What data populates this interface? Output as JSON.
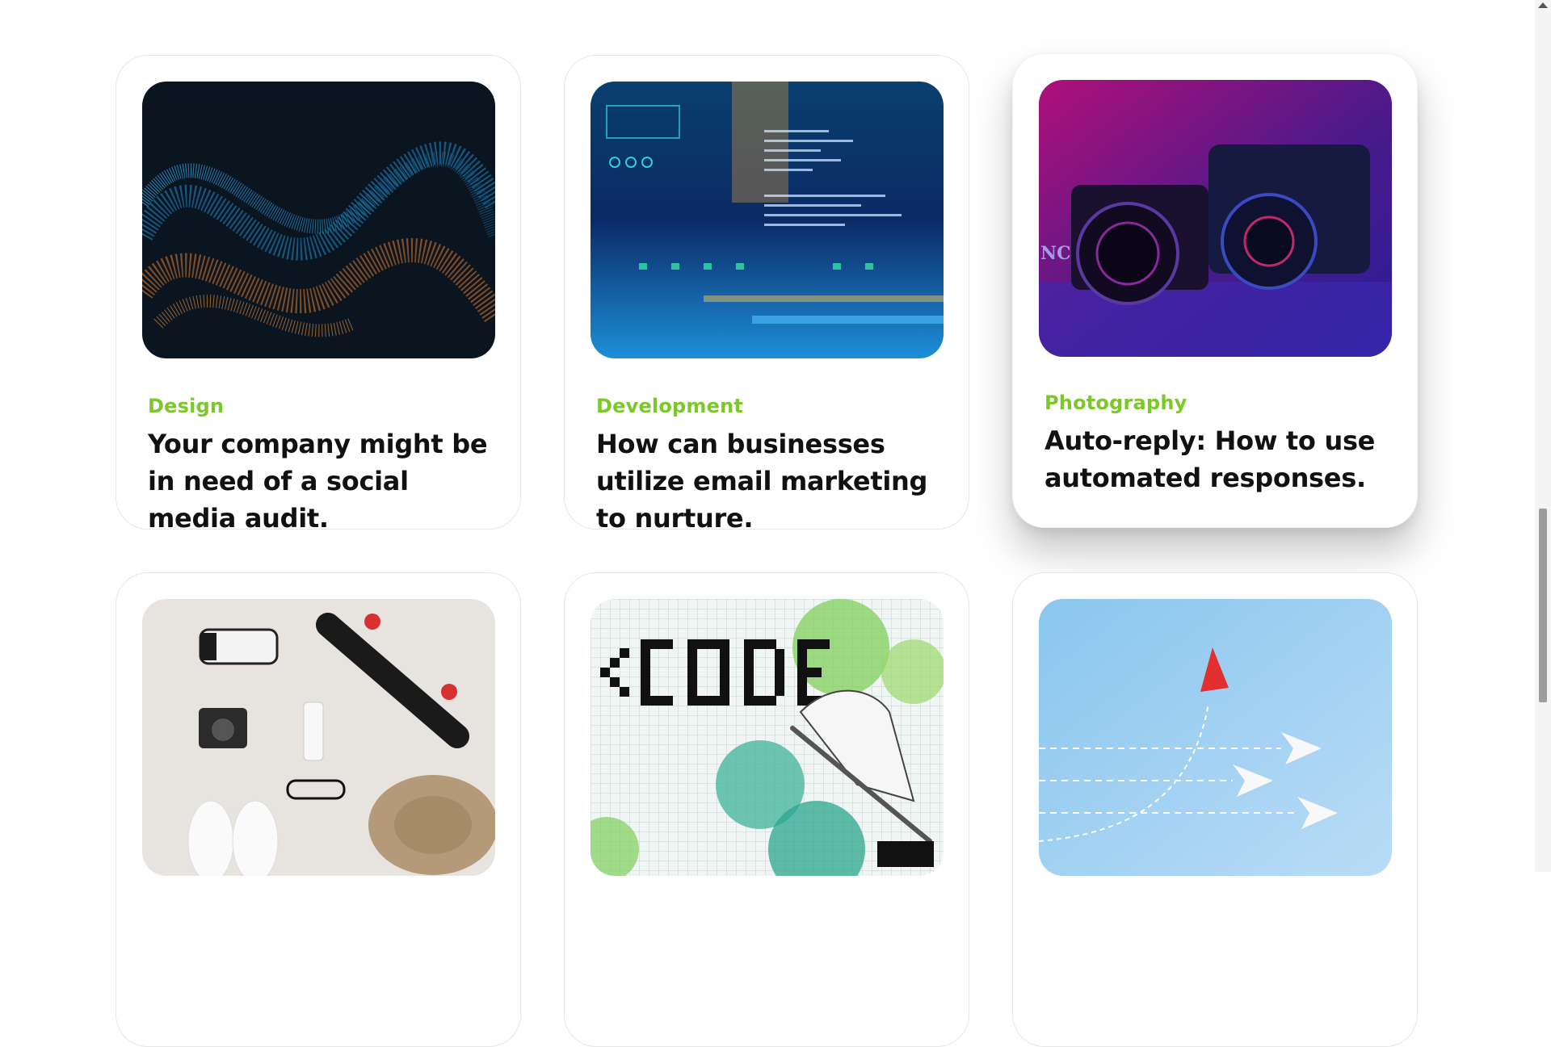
{
  "cards": [
    {
      "category": "Design",
      "title": "Your company might be in need of a social media audit.",
      "image": "particle-wave-image"
    },
    {
      "category": "Development",
      "title": "How can businesses utilize email marketing to nurture.",
      "image": "code-screen-image"
    },
    {
      "category": "Photography",
      "title": "Auto-reply: How to use automated responses.",
      "image": "cameras-image"
    },
    {
      "category": "",
      "title": "",
      "image": "flatlay-image"
    },
    {
      "category": "",
      "title": "",
      "image": "code-drawing-image"
    },
    {
      "category": "",
      "title": "",
      "image": "paper-planes-image"
    }
  ],
  "colors": {
    "category": "#7cc82a",
    "title": "#111111",
    "border": "#e6e6e6"
  }
}
